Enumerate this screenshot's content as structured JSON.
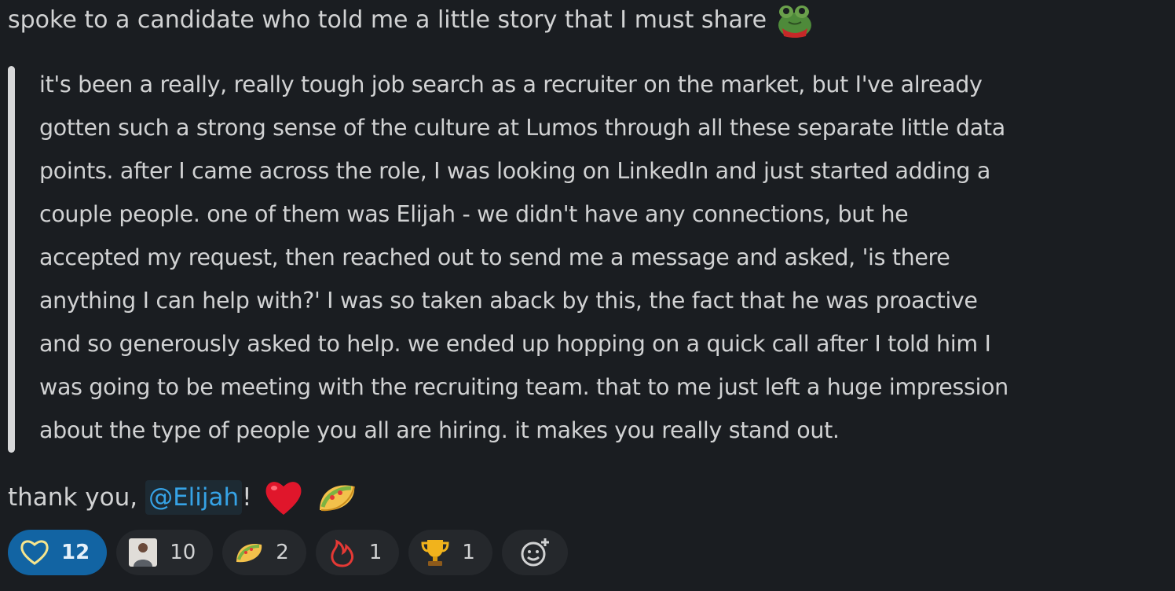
{
  "message": {
    "intro": "spoke to a candidate who told me a little story that I must share",
    "quote_lines": [
      "it's been a really, really tough job search as a recruiter on the market, but I've already",
      "gotten such a strong sense of the culture at Lumos through all these separate little data",
      "points. after I came across the role, I was looking on LinkedIn and just started adding a",
      "couple people. one of them was Elijah - we didn't have any connections, but he",
      "accepted my request, then reached out to send me a message and asked, 'is there",
      "anything I can help with?' I was so taken aback by this, the fact that he was proactive",
      "and so generously asked to help. we ended up hopping on a quick call after I told him I",
      "was going to be meeting with the recruiting team. that to me just left a huge impression",
      "about the type of people you all are hiring. it makes you really stand out."
    ],
    "thanks_prefix": "thank you,",
    "mention": "@Elijah",
    "thanks_suffix": "!"
  },
  "reactions": [
    {
      "icon": "heart-outline-icon",
      "count": "12",
      "active": true
    },
    {
      "icon": "person-avatar-icon",
      "count": "10",
      "active": false
    },
    {
      "icon": "taco-icon",
      "count": "2",
      "active": false
    },
    {
      "icon": "flame-icon",
      "count": "1",
      "active": false
    },
    {
      "icon": "trophy-icon",
      "count": "1",
      "active": false
    }
  ],
  "colors": {
    "background": "#1a1d21",
    "text": "#d1d2d3",
    "mention_text": "#36a3e6",
    "mention_bg": "#1d2a33",
    "active_reaction": "#1264a3",
    "reaction_bg": "#25282c"
  }
}
